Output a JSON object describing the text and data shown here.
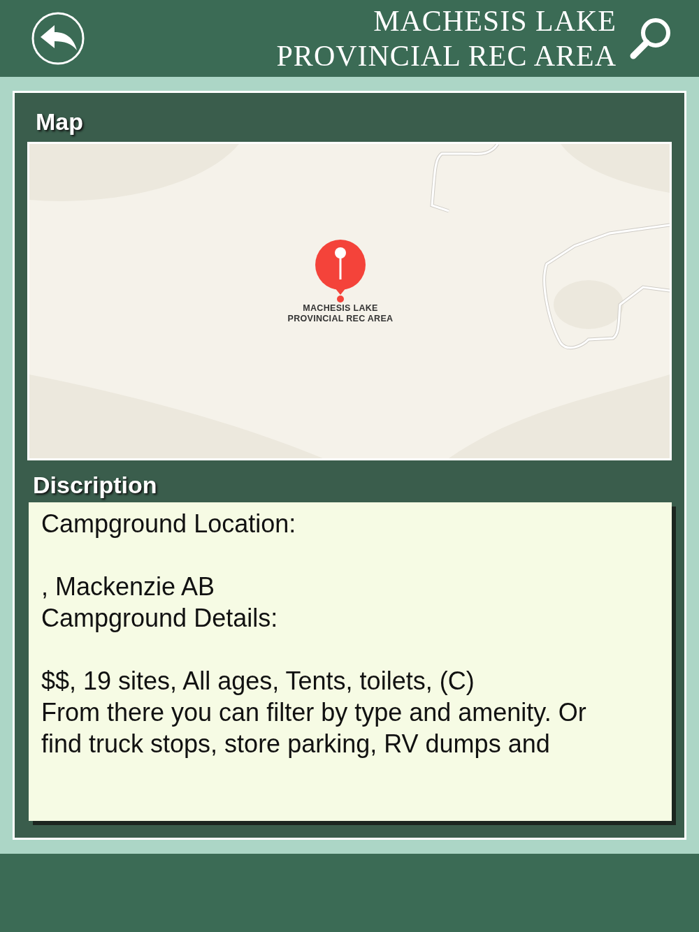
{
  "header": {
    "title_lines": [
      "MACHESIS LAKE",
      "PROVINCIAL REC AREA"
    ]
  },
  "map_section": {
    "heading": "Map",
    "pin": {
      "label_lines": [
        "MACHESIS LAKE",
        "PROVINCIAL REC AREA"
      ]
    }
  },
  "description_section": {
    "heading": "Discription",
    "blocks": [
      {
        "lines": [
          "Campground Location:"
        ]
      },
      {
        "lines": [
          ", Mackenzie AB",
          "Campground Details:"
        ]
      },
      {
        "lines": [
          "$$, 19 sites, All ages, Tents, toilets, (C)",
          "From there you can filter by type and amenity. Or find truck stops, store parking, RV dumps and"
        ]
      }
    ]
  }
}
